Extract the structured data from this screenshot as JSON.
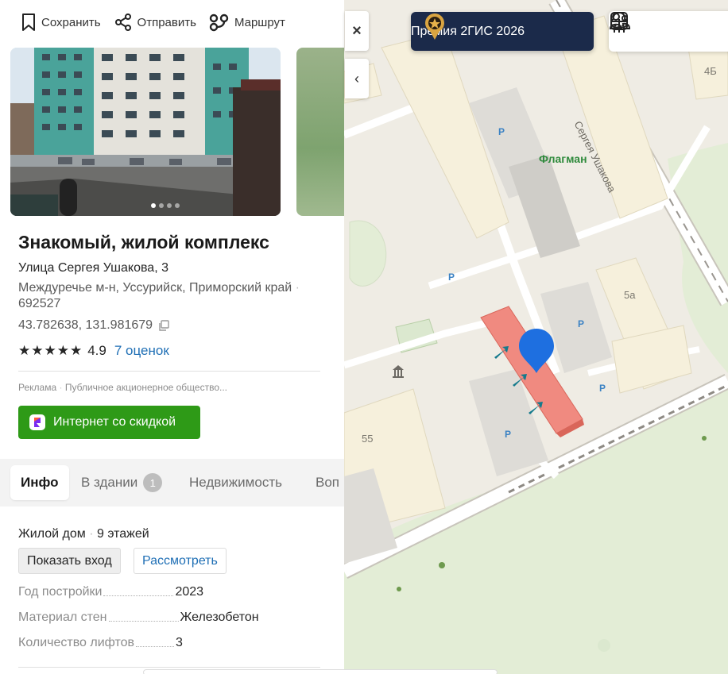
{
  "actions": {
    "save_label": "Сохранить",
    "share_label": "Отправить",
    "route_label": "Маршрут"
  },
  "gallery": {
    "photo_count": 4,
    "active_photo": 1
  },
  "place": {
    "title": "Знакомый, жилой комплекс",
    "street": "Улица Сергея Ушакова, 3",
    "district": "Междуречье м-н, Уссурийск, Приморский край",
    "postcode": "692527",
    "coordinates": "43.782638, 131.981679",
    "stars": "★★★★★",
    "rating": "4.9",
    "reviews": "7 оценок"
  },
  "ad": {
    "label": "Реклама",
    "advertiser": "Публичное акционерное общество...",
    "button_label": "Интернет со скидкой"
  },
  "tabs": [
    {
      "label": "Инфо",
      "active": true
    },
    {
      "label": "В здании",
      "count": "1"
    },
    {
      "label": "Недвижимость"
    },
    {
      "label": "Воп"
    }
  ],
  "building": {
    "type": "Жилой дом",
    "floors": "9 этажей",
    "show_entrance_label": "Показать вход",
    "inspect_label": "Рассмотреть",
    "properties": [
      {
        "key": "Год постройки",
        "value": "2023"
      },
      {
        "key": "Материал стен",
        "value": "Железобетон"
      },
      {
        "key": "Количество лифтов",
        "value": "3"
      }
    ]
  },
  "map": {
    "promo_label": "Премия 2ГИС 2026",
    "street_label": "Сергея Ушакова",
    "poi_label": "Флагман",
    "parking_symbol": "P",
    "house_numbers": [
      "4Б",
      "5а",
      "55"
    ],
    "building_color": "#f08a80",
    "marker_color": "#1e6fe0",
    "accent_green": "#2e9a17"
  }
}
